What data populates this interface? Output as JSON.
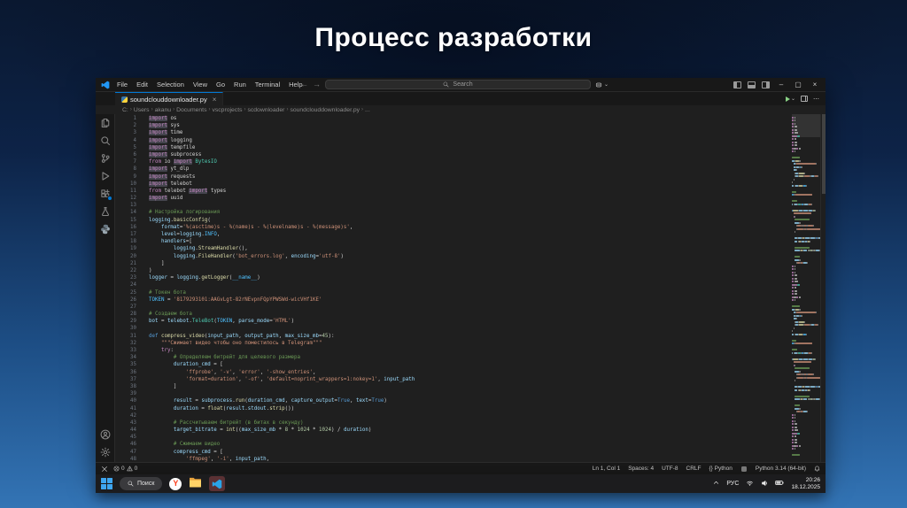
{
  "slide": {
    "title": "Процесс разработки"
  },
  "colors": {
    "accent": "#0078d4",
    "editor_bg": "#1f1f1f",
    "chrome_bg": "#181818",
    "slide_bottom_blue": "#3374b5",
    "keyword": "#C586C0",
    "string": "#CE9178",
    "comment": "#6A9955",
    "function": "#DCDCAA",
    "identifier": "#9CDCFE"
  },
  "vscode": {
    "menu": [
      "File",
      "Edit",
      "Selection",
      "View",
      "Go",
      "Run",
      "Terminal",
      "Help"
    ],
    "search_placeholder": "Search",
    "tab": {
      "filename": "soundclouddownloader.py",
      "close": "×"
    },
    "breadcrumbs": [
      "C:",
      "Users",
      "akanu",
      "Documents",
      "vscprojects",
      "scdownloader",
      "soundclouddownloader.py",
      "..."
    ],
    "window_controls": {
      "minimize": "–",
      "maximize": "▢",
      "close": "×"
    },
    "status": {
      "errors": "0",
      "warnings": "0",
      "cursor": "Ln 1, Col 1",
      "indent": "Spaces: 4",
      "encoding": "UTF-8",
      "eol": "CRLF",
      "language": "{} Python",
      "interpreter": "Python 3.14 (64-bit)"
    },
    "code": {
      "lines": [
        [
          [
            "kw",
            "import",
            1
          ],
          [
            "mod",
            " os"
          ]
        ],
        [
          [
            "kw",
            "import",
            1
          ],
          [
            "mod",
            " sys"
          ]
        ],
        [
          [
            "kw",
            "import",
            1
          ],
          [
            "mod",
            " time"
          ]
        ],
        [
          [
            "kw",
            "import",
            1
          ],
          [
            "mod",
            " logging"
          ]
        ],
        [
          [
            "kw",
            "import",
            1
          ],
          [
            "mod",
            " tempfile"
          ]
        ],
        [
          [
            "kw",
            "import",
            1
          ],
          [
            "mod",
            " subprocess"
          ]
        ],
        [
          [
            "kw",
            "from"
          ],
          [
            "mod",
            " io "
          ],
          [
            "kw",
            "import",
            1
          ],
          [
            "cls",
            " BytesIO"
          ]
        ],
        [
          [
            "kw",
            "import",
            1
          ],
          [
            "mod",
            " yt_dlp"
          ]
        ],
        [
          [
            "kw",
            "import",
            1
          ],
          [
            "mod",
            " requests"
          ]
        ],
        [
          [
            "kw",
            "import",
            1
          ],
          [
            "mod",
            " telebot"
          ]
        ],
        [
          [
            "kw",
            "from"
          ],
          [
            "mod",
            " telebot "
          ],
          [
            "kw",
            "import",
            1
          ],
          [
            "mod",
            " types"
          ]
        ],
        [
          [
            "kw",
            "import",
            1
          ],
          [
            "mod",
            " uuid"
          ]
        ],
        [],
        [
          [
            "com",
            "# Настройка логирования"
          ]
        ],
        [
          [
            "id",
            "logging"
          ],
          [
            "pl",
            "."
          ],
          [
            "fn",
            "basicConfig"
          ],
          [
            "pl",
            "("
          ]
        ],
        [
          [
            "id",
            "    format"
          ],
          [
            "pl",
            "="
          ],
          [
            "str",
            "'%(asctime)s - %(name)s - %(levelname)s - %(message)s'"
          ],
          [
            "pl",
            ","
          ]
        ],
        [
          [
            "id",
            "    level"
          ],
          [
            "pl",
            "="
          ],
          [
            "id",
            "logging"
          ],
          [
            "pl",
            "."
          ],
          [
            "const",
            "INFO"
          ],
          [
            "pl",
            ","
          ]
        ],
        [
          [
            "id",
            "    handlers"
          ],
          [
            "pl",
            "=["
          ]
        ],
        [
          [
            "pl",
            "        "
          ],
          [
            "id",
            "logging"
          ],
          [
            "pl",
            "."
          ],
          [
            "fn",
            "StreamHandler"
          ],
          [
            "pl",
            "(),"
          ]
        ],
        [
          [
            "pl",
            "        "
          ],
          [
            "id",
            "logging"
          ],
          [
            "pl",
            "."
          ],
          [
            "fn",
            "FileHandler"
          ],
          [
            "pl",
            "("
          ],
          [
            "str",
            "'bot_errors.log'"
          ],
          [
            "pl",
            ", "
          ],
          [
            "id",
            "encoding"
          ],
          [
            "pl",
            "="
          ],
          [
            "str",
            "'utf-8'"
          ],
          [
            "pl",
            ")"
          ]
        ],
        [
          [
            "pl",
            "    ]"
          ]
        ],
        [
          [
            "pl",
            ")"
          ]
        ],
        [
          [
            "id",
            "logger"
          ],
          [
            "pl",
            " = "
          ],
          [
            "id",
            "logging"
          ],
          [
            "pl",
            "."
          ],
          [
            "fn",
            "getLogger"
          ],
          [
            "pl",
            "("
          ],
          [
            "const",
            "__name__"
          ],
          [
            "pl",
            ")"
          ]
        ],
        [],
        [
          [
            "com",
            "# Токен бота"
          ]
        ],
        [
          [
            "const",
            "TOKEN"
          ],
          [
            "pl",
            " = "
          ],
          [
            "str",
            "'8179293101:AAGvLgt-82rNEvpnFQpYPWSWd-wicVHf1KE'"
          ]
        ],
        [],
        [
          [
            "com",
            "# Создаем бота"
          ]
        ],
        [
          [
            "id",
            "bot"
          ],
          [
            "pl",
            " = "
          ],
          [
            "id",
            "telebot"
          ],
          [
            "pl",
            "."
          ],
          [
            "cls",
            "TeleBot"
          ],
          [
            "pl",
            "("
          ],
          [
            "const",
            "TOKEN"
          ],
          [
            "pl",
            ", "
          ],
          [
            "id",
            "parse_mode"
          ],
          [
            "pl",
            "="
          ],
          [
            "str",
            "'HTML'"
          ],
          [
            "pl",
            ")"
          ]
        ],
        [],
        [
          [
            "kw2",
            "def "
          ],
          [
            "fn",
            "compress_video"
          ],
          [
            "pl",
            "("
          ],
          [
            "id",
            "input_path"
          ],
          [
            "pl",
            ", "
          ],
          [
            "id",
            "output_path"
          ],
          [
            "pl",
            ", "
          ],
          [
            "id",
            "max_size_mb"
          ],
          [
            "pl",
            "="
          ],
          [
            "num",
            "45"
          ],
          [
            "pl",
            "):"
          ]
        ],
        [
          [
            "str",
            "    \"\"\"Сжимает видео чтобы оно поместилось в Telegram\"\"\""
          ]
        ],
        [
          [
            "kw",
            "    try"
          ],
          [
            "pl",
            ":"
          ]
        ],
        [
          [
            "com",
            "        # Определяем битрейт для целевого размера"
          ]
        ],
        [
          [
            "id",
            "        duration_cmd"
          ],
          [
            "pl",
            " = ["
          ]
        ],
        [
          [
            "pl",
            "            "
          ],
          [
            "str",
            "'ffprobe'"
          ],
          [
            "pl",
            ", "
          ],
          [
            "str",
            "'-v'"
          ],
          [
            "pl",
            ", "
          ],
          [
            "str",
            "'error'"
          ],
          [
            "pl",
            ", "
          ],
          [
            "str",
            "'-show_entries'"
          ],
          [
            "pl",
            ","
          ]
        ],
        [
          [
            "pl",
            "            "
          ],
          [
            "str",
            "'format=duration'"
          ],
          [
            "pl",
            ", "
          ],
          [
            "str",
            "'-of'"
          ],
          [
            "pl",
            ", "
          ],
          [
            "str",
            "'default=noprint_wrappers=1:nokey=1'"
          ],
          [
            "pl",
            ", "
          ],
          [
            "id",
            "input_path"
          ]
        ],
        [
          [
            "pl",
            "        ]"
          ]
        ],
        [],
        [
          [
            "id",
            "        result"
          ],
          [
            "pl",
            " = "
          ],
          [
            "id",
            "subprocess"
          ],
          [
            "pl",
            "."
          ],
          [
            "fn",
            "run"
          ],
          [
            "pl",
            "("
          ],
          [
            "id",
            "duration_cmd"
          ],
          [
            "pl",
            ", "
          ],
          [
            "id",
            "capture_output"
          ],
          [
            "pl",
            "="
          ],
          [
            "kw2",
            "True"
          ],
          [
            "pl",
            ", "
          ],
          [
            "id",
            "text"
          ],
          [
            "pl",
            "="
          ],
          [
            "kw2",
            "True"
          ],
          [
            "pl",
            ")"
          ]
        ],
        [
          [
            "id",
            "        duration"
          ],
          [
            "pl",
            " = "
          ],
          [
            "fn",
            "float"
          ],
          [
            "pl",
            "("
          ],
          [
            "id",
            "result"
          ],
          [
            "pl",
            "."
          ],
          [
            "id",
            "stdout"
          ],
          [
            "pl",
            "."
          ],
          [
            "fn",
            "strip"
          ],
          [
            "pl",
            "())"
          ]
        ],
        [],
        [
          [
            "com",
            "        # Рассчитываем битрейт (в битах в секунду)"
          ]
        ],
        [
          [
            "id",
            "        target_bitrate"
          ],
          [
            "pl",
            " = "
          ],
          [
            "fn",
            "int"
          ],
          [
            "pl",
            "(("
          ],
          [
            "id",
            "max_size_mb"
          ],
          [
            "pl",
            " * "
          ],
          [
            "num",
            "8"
          ],
          [
            "pl",
            " * "
          ],
          [
            "num",
            "1024"
          ],
          [
            "pl",
            " * "
          ],
          [
            "num",
            "1024"
          ],
          [
            "pl",
            ") / "
          ],
          [
            "id",
            "duration"
          ],
          [
            "pl",
            ")"
          ]
        ],
        [],
        [
          [
            "com",
            "        # Сжимаем видео"
          ]
        ],
        [
          [
            "id",
            "        compress_cmd"
          ],
          [
            "pl",
            " = ["
          ]
        ],
        [
          [
            "pl",
            "            "
          ],
          [
            "str",
            "'ffmpeg'"
          ],
          [
            "pl",
            ", "
          ],
          [
            "str",
            "'-i'"
          ],
          [
            "pl",
            ", "
          ],
          [
            "id",
            "input_path"
          ],
          [
            "pl",
            ","
          ]
        ]
      ]
    }
  },
  "taskbar": {
    "search_label": "Поиск",
    "language": "РУС",
    "time": "20:26",
    "date": "18.12.2025"
  }
}
